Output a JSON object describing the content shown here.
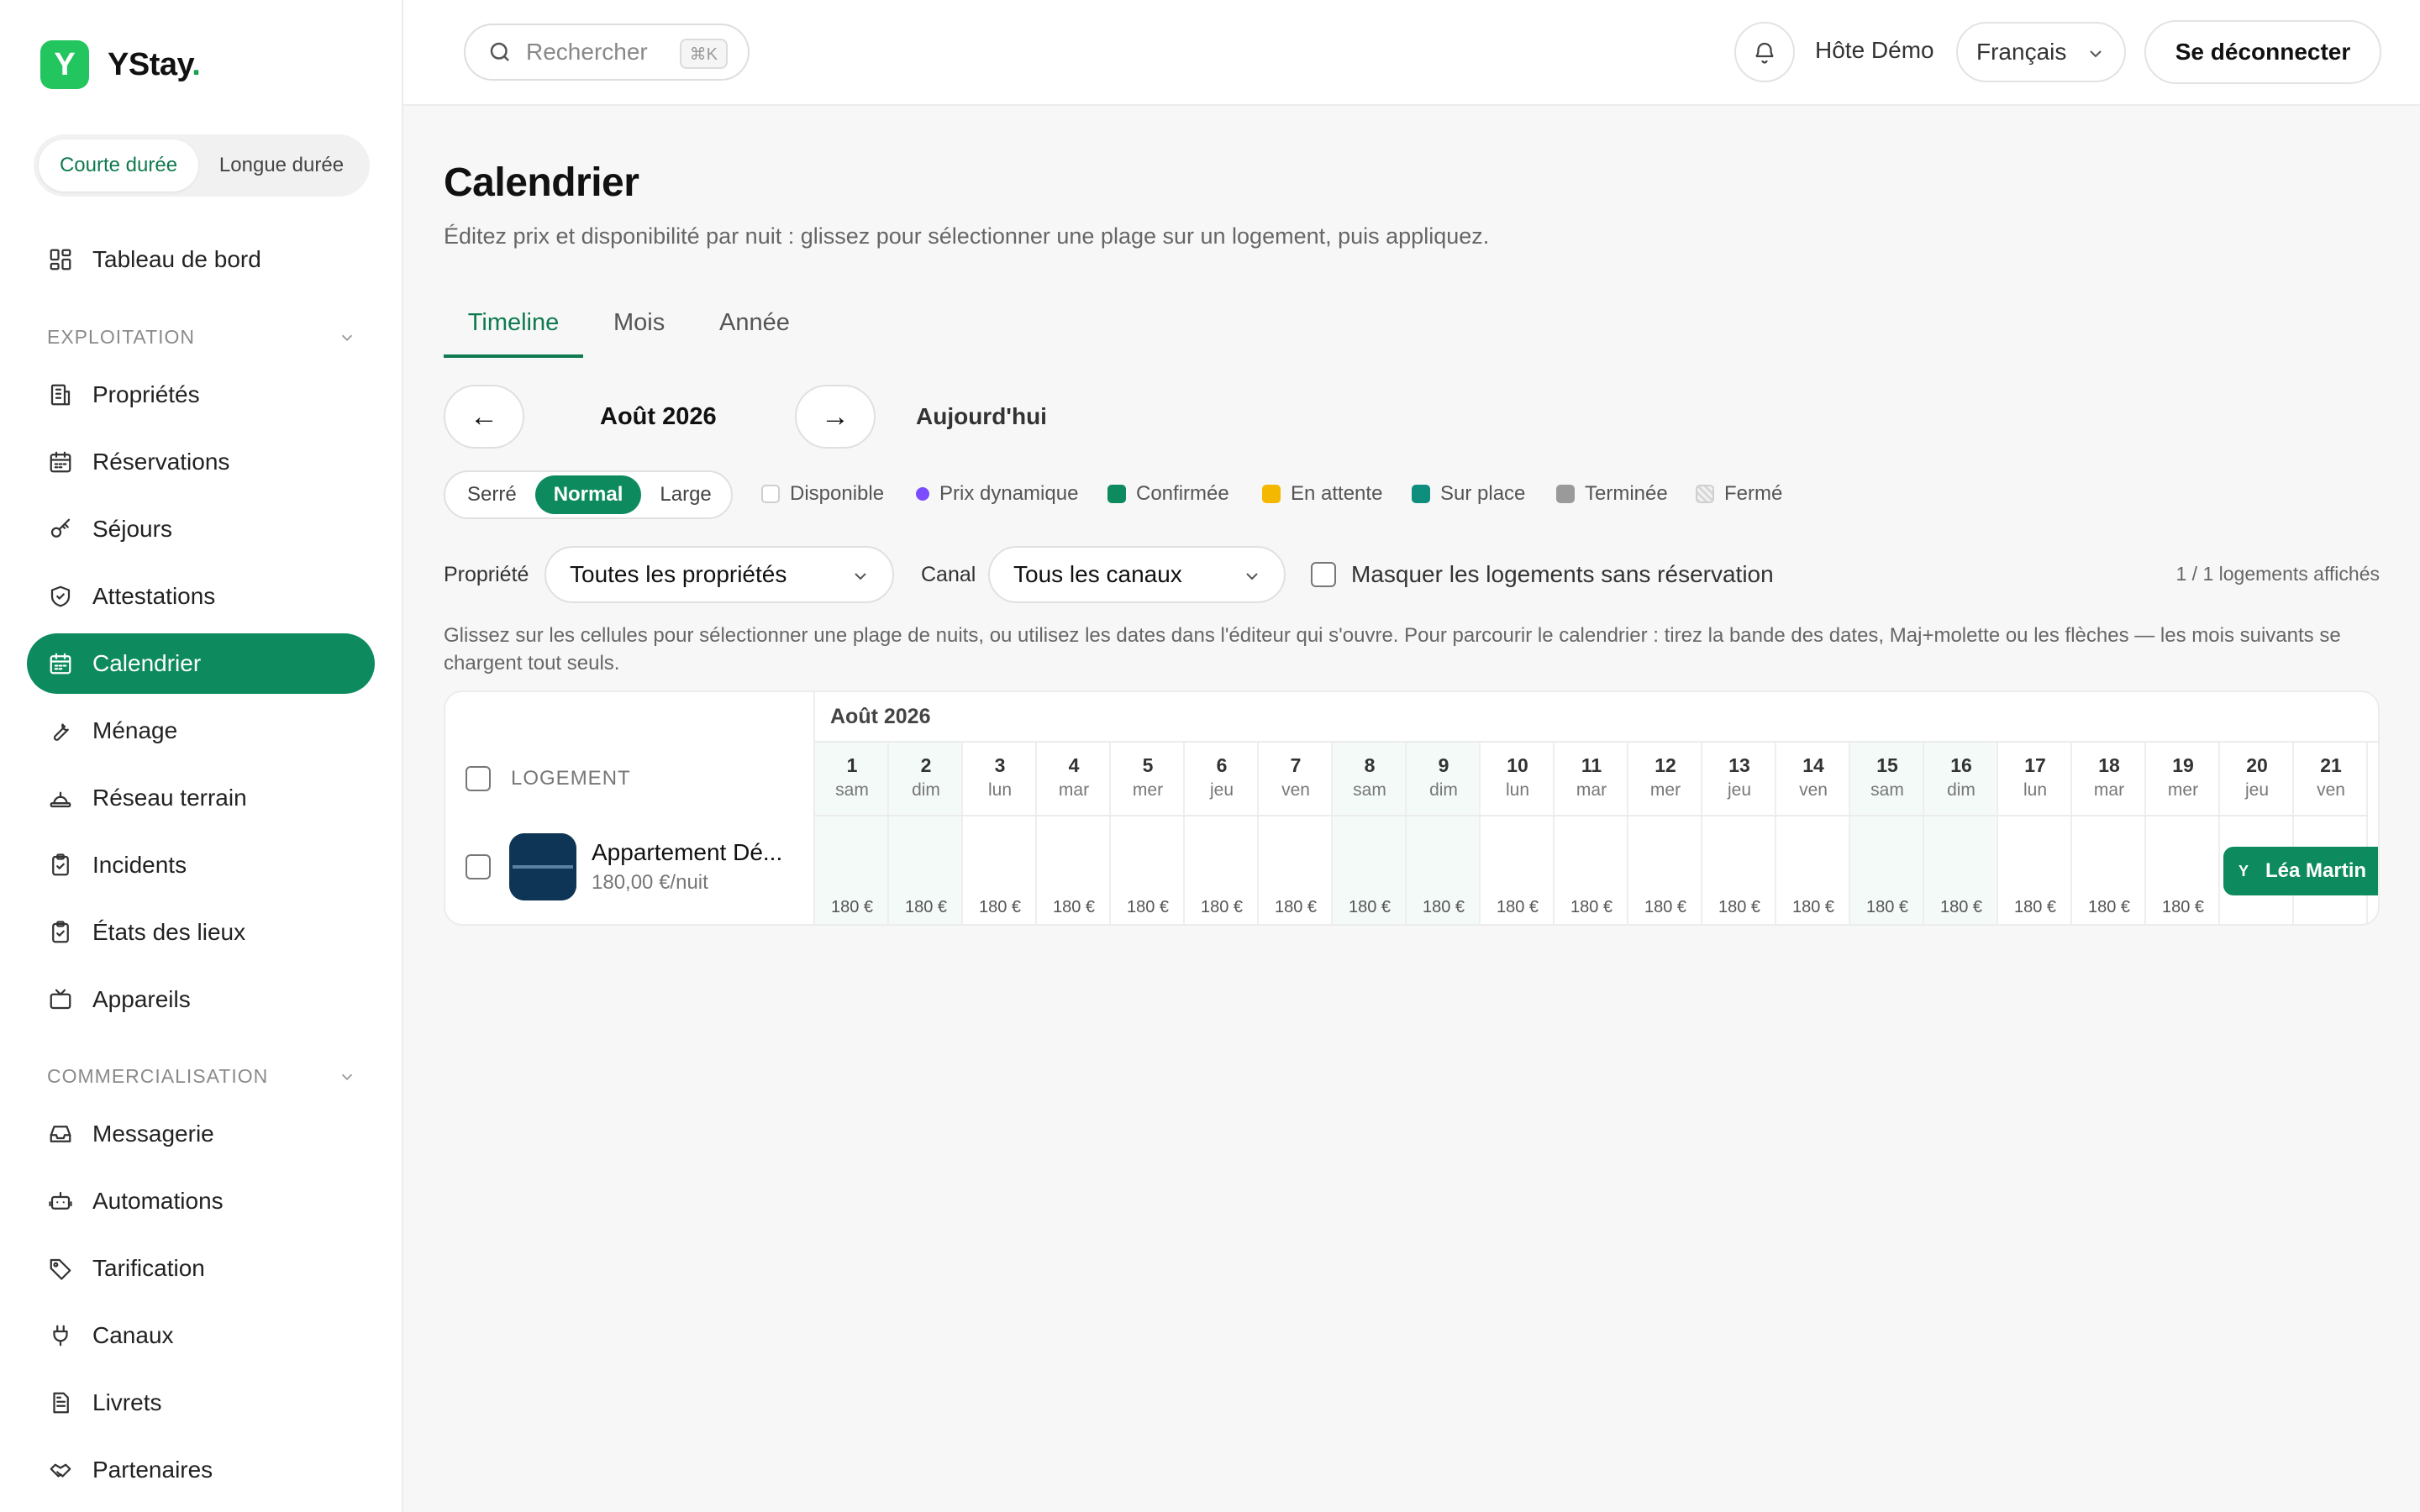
{
  "app": {
    "name": "YStay",
    "name_dot": ".",
    "logo_letter": "Y",
    "brand_color": "#0d8b5e",
    "logo_color": "#22c55e"
  },
  "mode_switch": {
    "short_term": "Courte durée",
    "long_term": "Longue durée"
  },
  "sidebar": {
    "dashboard": "Tableau de bord",
    "section_operations": "EXPLOITATION",
    "section_marketing": "COMMERCIALISATION",
    "items_operations": [
      {
        "label": "Propriétés",
        "icon": "building-icon"
      },
      {
        "label": "Réservations",
        "icon": "calendar-icon"
      },
      {
        "label": "Séjours",
        "icon": "key-icon"
      },
      {
        "label": "Attestations",
        "icon": "shield-icon"
      },
      {
        "label": "Calendrier",
        "icon": "calendar-icon",
        "active": true
      },
      {
        "label": "Ménage",
        "icon": "wrench-icon"
      },
      {
        "label": "Réseau terrain",
        "icon": "hat-icon"
      },
      {
        "label": "Incidents",
        "icon": "clipboard-icon"
      },
      {
        "label": "États des lieux",
        "icon": "clipboard-icon"
      },
      {
        "label": "Appareils",
        "icon": "tv-icon"
      }
    ],
    "items_marketing": [
      {
        "label": "Messagerie",
        "icon": "inbox-icon"
      },
      {
        "label": "Automations",
        "icon": "robot-icon"
      },
      {
        "label": "Tarification",
        "icon": "tag-icon"
      },
      {
        "label": "Canaux",
        "icon": "plug-icon"
      },
      {
        "label": "Livrets",
        "icon": "document-icon"
      },
      {
        "label": "Partenaires",
        "icon": "handshake-icon"
      }
    ]
  },
  "topbar": {
    "search_placeholder": "Rechercher",
    "search_shortcut": "⌘K",
    "host_name": "Hôte Démo",
    "language": "Français",
    "logout": "Se déconnecter"
  },
  "page": {
    "title": "Calendrier",
    "subtitle": "Éditez prix et disponibilité par nuit : glissez pour sélectionner une plage sur un logement, puis appliquez.",
    "tabs": [
      "Timeline",
      "Mois",
      "Année"
    ],
    "active_tab": "Timeline",
    "prev_arrow": "←",
    "next_arrow": "→",
    "current_month": "Août 2026",
    "today": "Aujourd'hui",
    "density": [
      "Serré",
      "Normal",
      "Large"
    ],
    "active_density": "Normal",
    "legend": [
      {
        "label": "Disponible",
        "color": "#ffffff"
      },
      {
        "label": "Prix dynamique",
        "color": "#7c4dff"
      },
      {
        "label": "Confirmée",
        "color": "#0d8b5e"
      },
      {
        "label": "En attente",
        "color": "#f5b800"
      },
      {
        "label": "Sur place",
        "color": "#0e8f7e"
      },
      {
        "label": "Terminée",
        "color": "#9a9a9a"
      },
      {
        "label": "Fermé",
        "color": "#dddddd"
      }
    ],
    "filters": {
      "property_label": "Propriété",
      "property_value": "Toutes les propriétés",
      "channel_label": "Canal",
      "channel_value": "Tous les canaux",
      "hide_empty": "Masquer les logements sans réservation",
      "count": "1 / 1 logements affichés"
    },
    "hint": "Glissez sur les cellules pour sélectionner une plage de nuits, ou utilisez les dates dans l'éditeur qui s'ouvre. Pour parcourir le calendrier : tirez la bande des dates, Maj+molette ou les flèches — les mois suivants se chargent tout seuls."
  },
  "calendar": {
    "month_band": "Août 2026",
    "logement_header": "LOGEMENT",
    "property": {
      "name": "Appartement Dé...",
      "price": "180,00 €/nuit"
    },
    "days": [
      {
        "num": "1",
        "wd": "sam",
        "price": "180 €",
        "weekend": true
      },
      {
        "num": "2",
        "wd": "dim",
        "price": "180 €",
        "weekend": true
      },
      {
        "num": "3",
        "wd": "lun",
        "price": "180 €"
      },
      {
        "num": "4",
        "wd": "mar",
        "price": "180 €"
      },
      {
        "num": "5",
        "wd": "mer",
        "price": "180 €"
      },
      {
        "num": "6",
        "wd": "jeu",
        "price": "180 €"
      },
      {
        "num": "7",
        "wd": "ven",
        "price": "180 €"
      },
      {
        "num": "8",
        "wd": "sam",
        "price": "180 €",
        "weekend": true
      },
      {
        "num": "9",
        "wd": "dim",
        "price": "180 €",
        "weekend": true
      },
      {
        "num": "10",
        "wd": "lun",
        "price": "180 €"
      },
      {
        "num": "11",
        "wd": "mar",
        "price": "180 €"
      },
      {
        "num": "12",
        "wd": "mer",
        "price": "180 €"
      },
      {
        "num": "13",
        "wd": "jeu",
        "price": "180 €"
      },
      {
        "num": "14",
        "wd": "ven",
        "price": "180 €"
      },
      {
        "num": "15",
        "wd": "sam",
        "price": "180 €",
        "weekend": true
      },
      {
        "num": "16",
        "wd": "dim",
        "price": "180 €",
        "weekend": true
      },
      {
        "num": "17",
        "wd": "lun",
        "price": "180 €"
      },
      {
        "num": "18",
        "wd": "mar",
        "price": "180 €"
      },
      {
        "num": "19",
        "wd": "mer",
        "price": "180 €"
      },
      {
        "num": "20",
        "wd": "jeu",
        "price": ""
      },
      {
        "num": "21",
        "wd": "ven",
        "price": ""
      }
    ],
    "booking": {
      "guest": "Léa Martin",
      "channel_badge": "Y",
      "start_day": "20"
    }
  }
}
